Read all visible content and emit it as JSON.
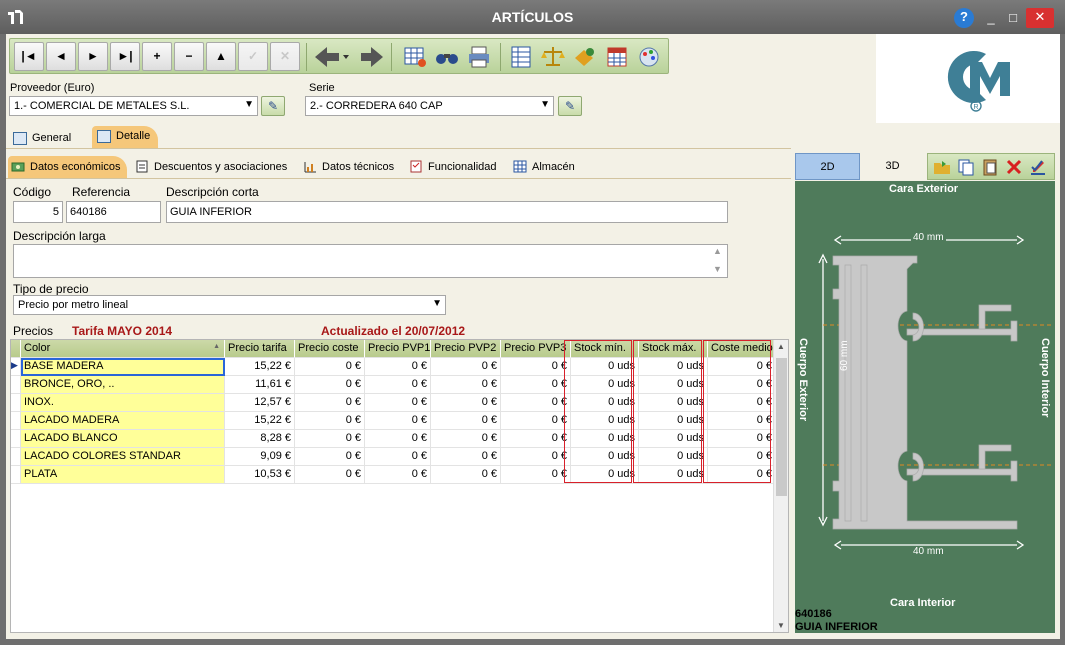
{
  "window": {
    "title": "ARTÍCULOS",
    "help": "?",
    "minimize": "_",
    "maximize": "□",
    "close": "✕"
  },
  "toolbar": {
    "first": "|◄",
    "prev": "◄",
    "next": "►",
    "last": "►|",
    "add": "+",
    "remove": "−",
    "up": "▲",
    "confirm": "✓",
    "cancel": "✕"
  },
  "proveedor": {
    "label": "Proveedor (Euro)",
    "value": "1.- COMERCIAL DE METALES S.L."
  },
  "serie": {
    "label": "Serie",
    "value": "2.- CORREDERA 640 CAP"
  },
  "tabs": {
    "general": "General",
    "detalle": "Detalle"
  },
  "subtabs": {
    "economicos": "Datos económicos",
    "descuentos": "Descuentos y asociaciones",
    "tecnicos": "Datos técnicos",
    "funcionalidad": "Funcionalidad",
    "almacen": "Almacén"
  },
  "fields": {
    "codigo_label": "Código",
    "codigo": "5",
    "referencia_label": "Referencia",
    "referencia": "640186",
    "desc_corta_label": "Descripción corta",
    "desc_corta": "GUIA INFERIOR",
    "desc_larga_label": "Descripción larga",
    "desc_larga": "",
    "tipo_precio_label": "Tipo de precio",
    "tipo_precio": "Precio por metro lineal"
  },
  "precios": {
    "label": "Precios",
    "tarifa": "Tarifa MAYO 2014",
    "actualizado": "Actualizado el 20/07/2012"
  },
  "grid": {
    "headers": [
      "Color",
      "Precio tarifa",
      "Precio coste",
      "Precio PVP1",
      "Precio PVP2",
      "Precio PVP3",
      "Stock mín.",
      "Stock máx.",
      "Coste medio"
    ],
    "rows": [
      [
        "BASE MADERA",
        "15,22 €",
        "0 €",
        "0 €",
        "0 €",
        "0 €",
        "0 uds",
        "0 uds",
        "0 €"
      ],
      [
        "BRONCE, ORO, ..",
        "11,61 €",
        "0 €",
        "0 €",
        "0 €",
        "0 €",
        "0 uds",
        "0 uds",
        "0 €"
      ],
      [
        "INOX.",
        "12,57 €",
        "0 €",
        "0 €",
        "0 €",
        "0 €",
        "0 uds",
        "0 uds",
        "0 €"
      ],
      [
        "LACADO  MADERA",
        "15,22 €",
        "0 €",
        "0 €",
        "0 €",
        "0 €",
        "0 uds",
        "0 uds",
        "0 €"
      ],
      [
        "LACADO BLANCO",
        "8,28 €",
        "0 €",
        "0 €",
        "0 €",
        "0 €",
        "0 uds",
        "0 uds",
        "0 €"
      ],
      [
        "LACADO COLORES STANDAR",
        "9,09 €",
        "0 €",
        "0 €",
        "0 €",
        "0 €",
        "0 uds",
        "0 uds",
        "0 €"
      ],
      [
        "PLATA",
        "10,53 €",
        "0 €",
        "0 €",
        "0 €",
        "0 €",
        "0 uds",
        "0 uds",
        "0 €"
      ]
    ]
  },
  "drawing": {
    "btn_2d": "2D",
    "btn_3d": "3D",
    "cara_exterior": "Cara Exterior",
    "cara_interior": "Cara Interior",
    "cuerpo_exterior": "Cuerpo Exterior",
    "cuerpo_interior": "Cuerpo Interior",
    "dim_top": "40 mm",
    "dim_bottom": "40 mm",
    "dim_side": "60 mm",
    "ref": "640186",
    "desc": "GUIA INFERIOR"
  },
  "colors": {
    "accent": "#f5c77a",
    "drawing_bg": "#4f7b5b",
    "grid_yellow": "#ffff99",
    "toolbar_green": "#c7dcaa",
    "red_box": "#d8202a"
  }
}
